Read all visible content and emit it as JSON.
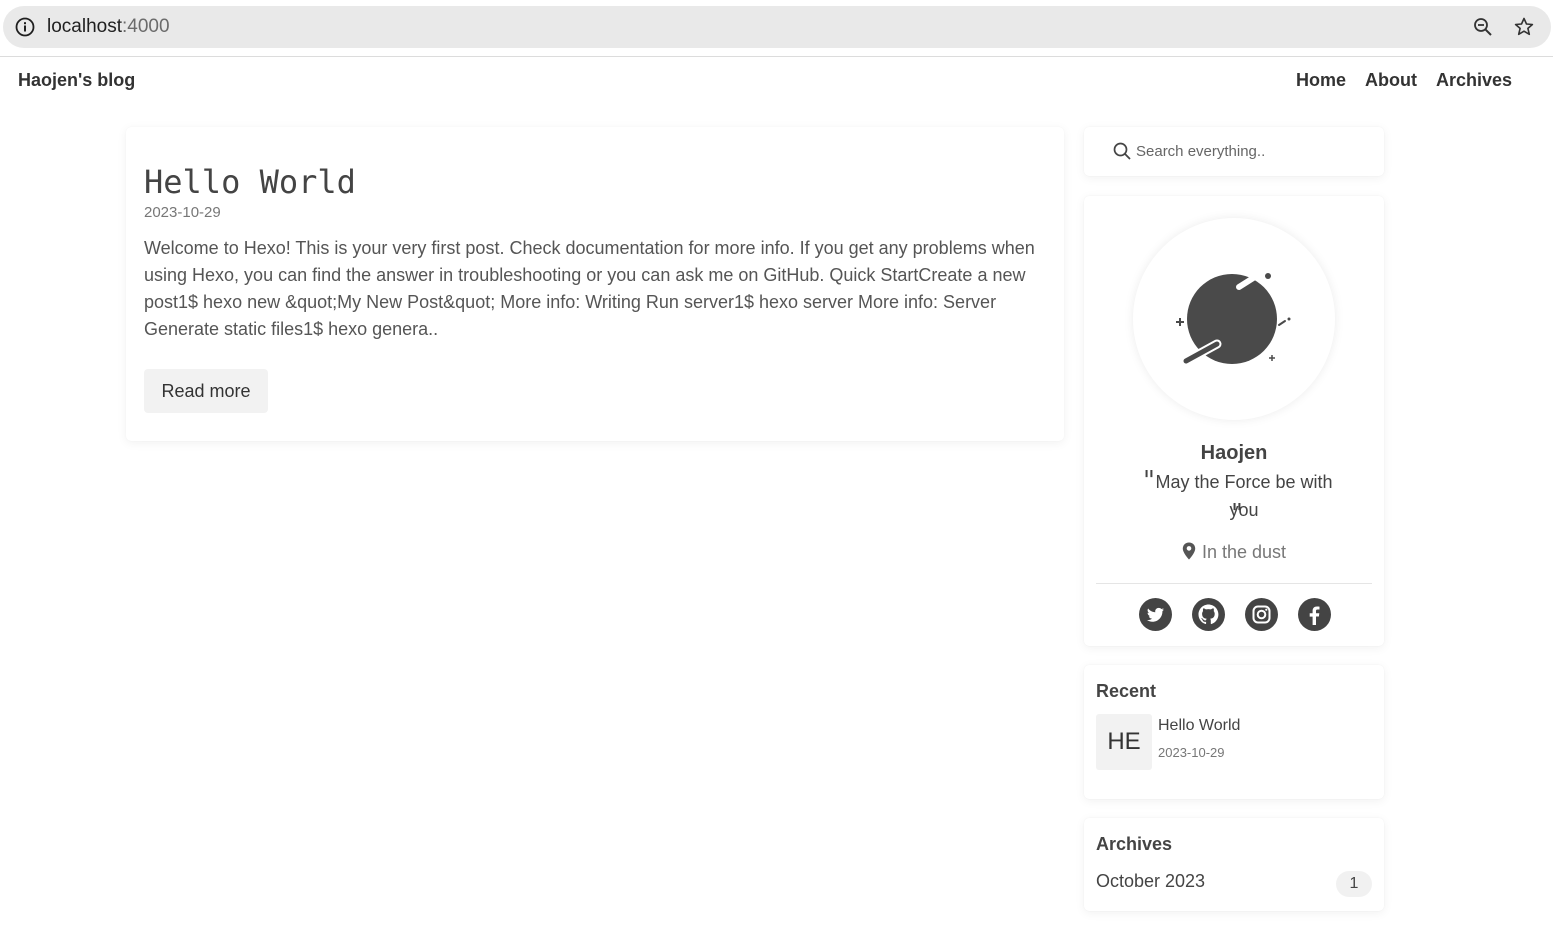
{
  "browser": {
    "url_host": "localhost",
    "url_port": ":4000"
  },
  "nav": {
    "brand": "Haojen's blog",
    "links": [
      "Home",
      "About",
      "Archives"
    ]
  },
  "post": {
    "title": "Hello World",
    "date": "2023-10-29",
    "excerpt": "Welcome to Hexo! This is your very first post. Check documentation for more info. If you get any problems when using Hexo, you can find the answer in troubleshooting or you can ask me on GitHub. Quick StartCreate a new post1$ hexo new &quot;My New Post&quot; More info: Writing Run server1$ hexo server More info: Server Generate static files1$ hexo genera..",
    "read_more": "Read more"
  },
  "search": {
    "placeholder": "Search everything.."
  },
  "profile": {
    "name": "Haojen",
    "motto": "May the Force be with you",
    "location": "In the dust",
    "socials": [
      "twitter-icon",
      "github-icon",
      "instagram-icon",
      "facebook-icon"
    ]
  },
  "recent": {
    "title": "Recent",
    "items": [
      {
        "thumb": "HE",
        "title": "Hello World",
        "date": "2023-10-29"
      }
    ]
  },
  "archives": {
    "title": "Archives",
    "items": [
      {
        "label": "October 2023",
        "count": "1"
      }
    ]
  },
  "colors": {
    "text": "#333333",
    "muted": "#777777",
    "address_bar": "#e9e9e9",
    "button_bg": "#f2f2f2",
    "icon": "#4a4a4a"
  }
}
